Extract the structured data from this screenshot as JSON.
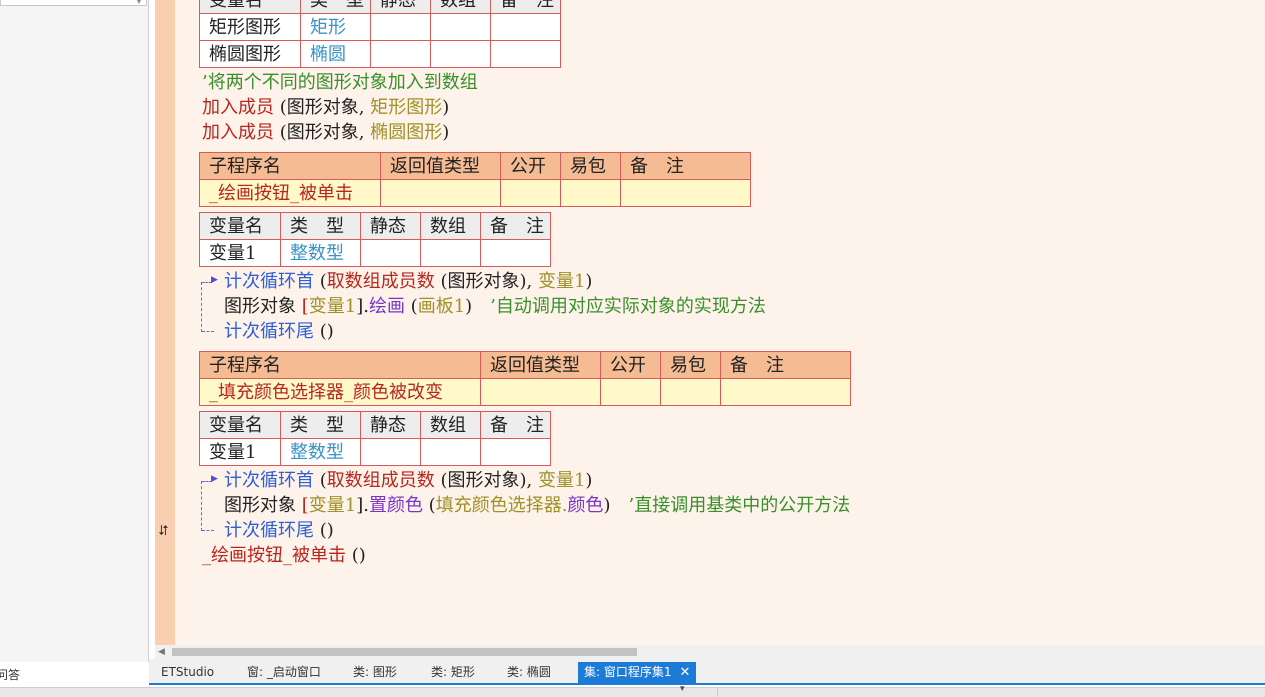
{
  "var_headers": [
    "变量名",
    "类　型",
    "静态",
    "数组",
    "备　注"
  ],
  "var_headers_clipped": [
    "变量名",
    "类　型",
    "静态",
    "数组",
    "备　注"
  ],
  "sub_headers": [
    "子程序名",
    "返回值类型",
    "公开",
    "易包",
    "备　注"
  ],
  "top_table": {
    "rows": [
      {
        "name": "矩形图形",
        "type": "矩形"
      },
      {
        "name": "椭圆图形",
        "type": "椭圆"
      }
    ]
  },
  "comment_add": "’将两个不同的图形对象加入到数组",
  "add_member_1": {
    "func": "加入成员",
    "open": " (",
    "arg1": "图形对象",
    "sep": ", ",
    "arg2": "矩形图形",
    "close": ")"
  },
  "add_member_2": {
    "func": "加入成员",
    "open": " (",
    "arg1": "图形对象",
    "sep": ", ",
    "arg2": "椭圆图形",
    "close": ")"
  },
  "sub1": {
    "name": "_绘画按钮_被单击",
    "var_name": "变量1",
    "var_type": "整数型",
    "loop_head": {
      "kw": "计次循环首",
      "open": " (",
      "fn": "取数组成员数",
      "open2": " (",
      "arg": "图形对象",
      "close2": "), ",
      "var": "变量1",
      "close": ")"
    },
    "body": {
      "obj": "图形对象",
      "br_open": " [",
      "idx": "变量1",
      "br_close": "].",
      "method": "绘画",
      "p_open": " (",
      "param": "画板1",
      "p_close": ")",
      "comment": "　’自动调用对应实际对象的实现方法"
    },
    "loop_tail": {
      "kw": "计次循环尾",
      "paren": " ()"
    }
  },
  "sub2": {
    "name": "_填充颜色选择器_颜色被改变",
    "var_name": "变量1",
    "var_type": "整数型",
    "loop_head": {
      "kw": "计次循环首",
      "open": " (",
      "fn": "取数组成员数",
      "open2": " (",
      "arg": "图形对象",
      "close2": "), ",
      "var": "变量1",
      "close": ")"
    },
    "body": {
      "obj": "图形对象",
      "br_open": " [",
      "idx": "变量1",
      "br_close": "].",
      "method": "置颜色",
      "p_open": " (",
      "param_obj": "填充颜色选择器.",
      "param_prop": "颜色",
      "p_close": ")",
      "comment": "　’直接调用基类中的公开方法"
    },
    "loop_tail": {
      "kw": "计次循环尾",
      "paren": " ()"
    }
  },
  "final_call": {
    "name": "_绘画按钮_被单击",
    "paren": " ()"
  },
  "left_caption": "问答",
  "tabs": [
    {
      "label": "ETStudio",
      "active": false
    },
    {
      "label": "窗: _启动窗口",
      "active": false
    },
    {
      "label": "类: 图形",
      "active": false
    },
    {
      "label": "类: 矩形",
      "active": false
    },
    {
      "label": "类: 椭圆",
      "active": false
    },
    {
      "label": "集: 窗口程序集1",
      "active": true
    }
  ],
  "icons": {
    "jump": "jump-arrow-icon",
    "close": "close-icon",
    "scroll_left": "scroll-left-arrow-icon"
  },
  "colors": {
    "keyword_red": "#b8261e",
    "loop_blue": "#2f5fd6",
    "type_teal": "#3a92c7",
    "comment_green": "#3a8f2b",
    "arg_olive": "#a09028",
    "method_purple": "#7a35c8",
    "sub_header": "#f5bb93",
    "sub_value": "#fff8c8",
    "margin": "#f9cfb0",
    "editor_bg": "#fdf3ea",
    "tab_active": "#1c7bd6"
  }
}
